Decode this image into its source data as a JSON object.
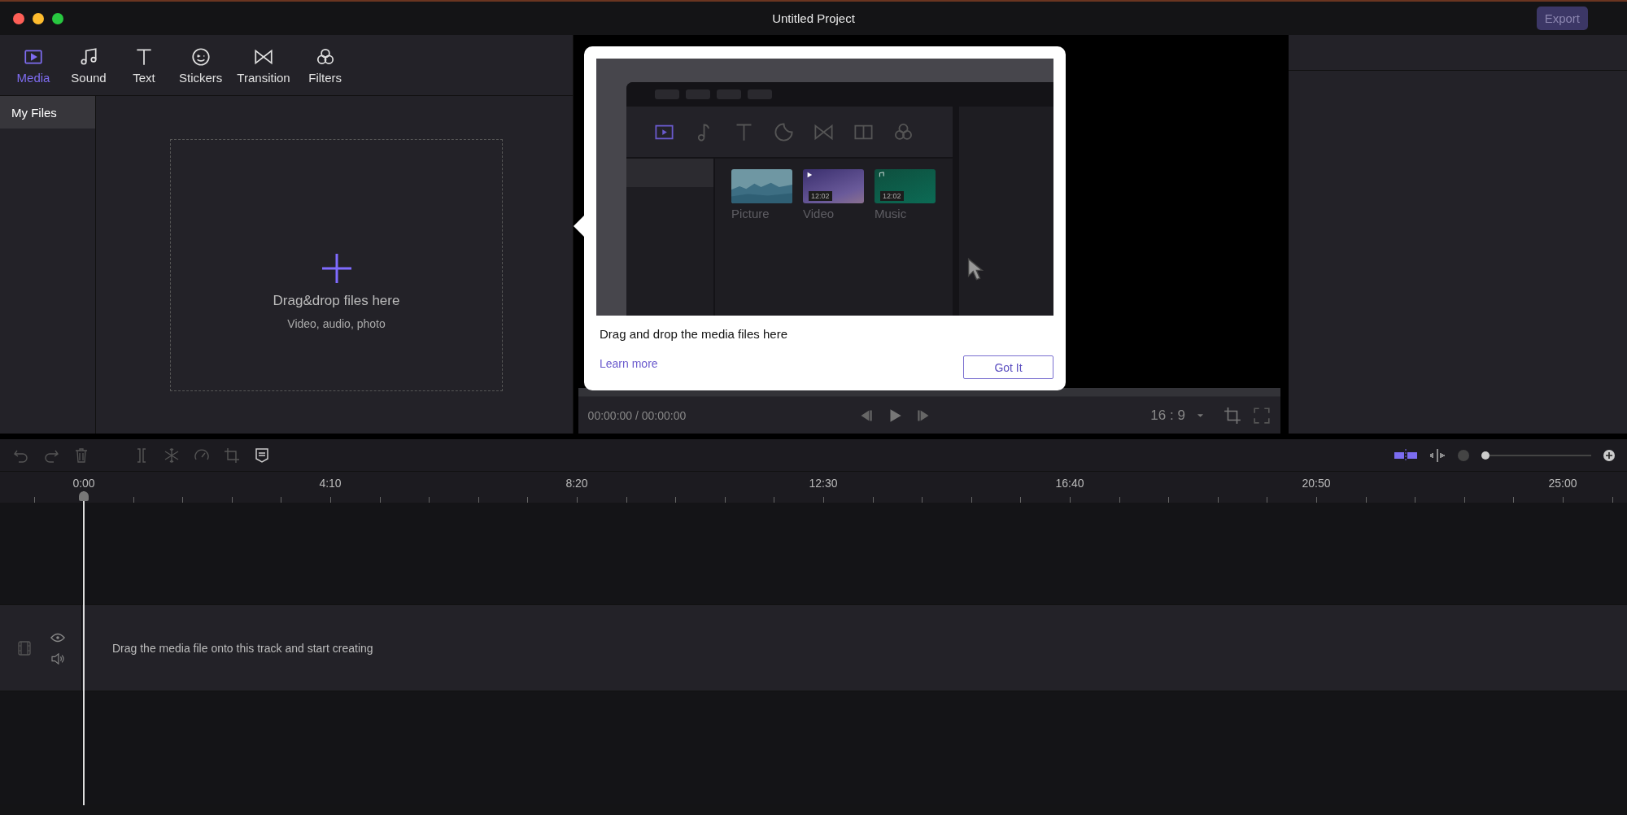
{
  "window": {
    "title": "Untitled Project"
  },
  "export_button": "Export",
  "media_tabs": [
    {
      "label": "Media",
      "kind": "media",
      "selected": true
    },
    {
      "label": "Sound",
      "kind": "sound",
      "selected": false
    },
    {
      "label": "Text",
      "kind": "text",
      "selected": false
    },
    {
      "label": "Stickers",
      "kind": "stickers",
      "selected": false
    },
    {
      "label": "Transition",
      "kind": "transition",
      "selected": false
    },
    {
      "label": "Filters",
      "kind": "filters",
      "selected": false
    }
  ],
  "sidebar": {
    "items": [
      {
        "label": "My Files",
        "selected": true
      }
    ]
  },
  "drop_zone": {
    "title": "Drag&drop files here",
    "subtitle": "Video, audio, photo"
  },
  "tooltip": {
    "preview": {
      "tiles": [
        {
          "label": "Picture",
          "kind": "picture"
        },
        {
          "label": "Video",
          "kind": "video",
          "duration": "12:02"
        },
        {
          "label": "Music",
          "kind": "music",
          "duration": "12:02"
        }
      ]
    },
    "message": "Drag and drop the media files here",
    "link": "Learn more",
    "button": "Got It"
  },
  "player": {
    "time": "00:00:00 / 00:00:00",
    "aspect_ratio": "16 : 9"
  },
  "timeline": {
    "ruler": [
      "0:00",
      "4:10",
      "8:20",
      "12:30",
      "16:40",
      "20:50",
      "25:00"
    ],
    "zoom": {
      "level": 0
    },
    "track_hint": "Drag the media file onto this track and start creating"
  }
}
